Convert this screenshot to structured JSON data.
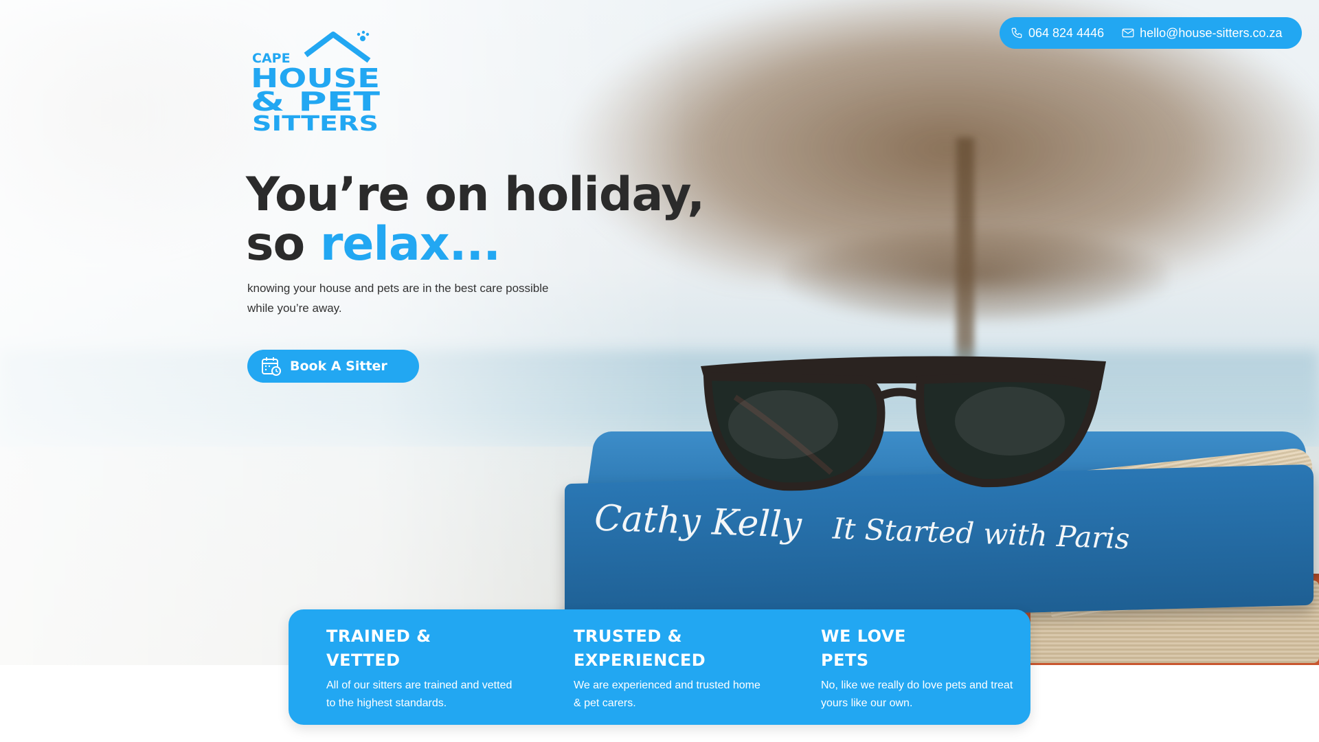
{
  "brand": {
    "logo_line1": "CAPE",
    "logo_line2": "HOUSE",
    "logo_line3": "& PET",
    "logo_line4": "SITTERS",
    "accent_color": "#22a7f2",
    "text_color": "#2b2b2b"
  },
  "contact": {
    "phone": "064 824 4446",
    "email": "hello@house-sitters.co.za",
    "phone_icon": "phone-icon",
    "email_icon": "envelope-icon"
  },
  "hero": {
    "headline_line1": "You’re on holiday,",
    "headline_prefix": "so",
    "headline_accent": "relax...",
    "subtext": "knowing your house and pets are in the best care possible while you’re away.",
    "cta_label": "Book A Sitter",
    "cta_icon": "calendar-clock-icon",
    "book_author": "Cathy Kelly",
    "book_title": "It Started with Paris"
  },
  "features": [
    {
      "title_line1": "TRAINED &",
      "title_line2": "VETTED",
      "text": "All of our sitters are trained and vetted to the highest standards."
    },
    {
      "title_line1": "TRUSTED &",
      "title_line2": "EXPERIENCED",
      "text": "We are experienced and trusted home & pet carers."
    },
    {
      "title_line1": "WE LOVE",
      "title_line2": "PETS",
      "text": "No, like we really do love pets and treat yours like our own."
    }
  ]
}
